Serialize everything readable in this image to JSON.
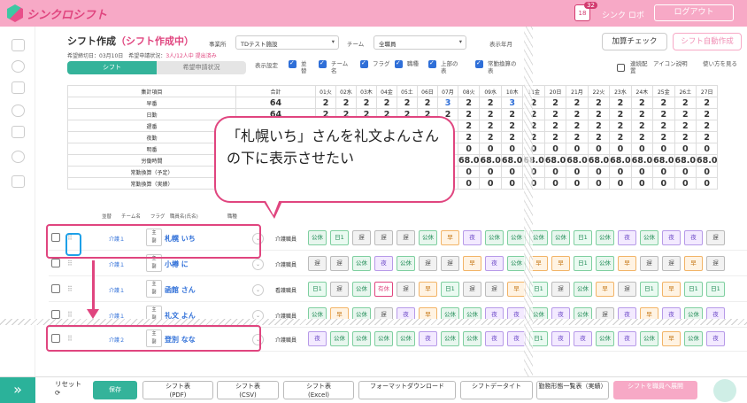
{
  "app": {
    "name": "シンクロシフト",
    "notif_count": "32",
    "calendar_day": "18",
    "robot": "シンク ロボ",
    "logout": "ログアウト"
  },
  "header": {
    "title": "シフト作成",
    "status": "（シフト作成中）",
    "office_label": "事業所",
    "office_value": "TDテスト施設",
    "team_label": "チーム",
    "team_value": "全職員",
    "month_label": "表示年月",
    "btn_add": "加算チェック",
    "btn_auto": "シフト自動作成"
  },
  "note": {
    "deadline": "希望締切日：03月10日",
    "state": "希望申請状況：",
    "state_value": "3人/12人中 提出済み"
  },
  "tabs": [
    "シフト",
    "希望申請状況"
  ],
  "options": {
    "label": "表示設定",
    "items": [
      "並替",
      "チーム名",
      "フラグ",
      "職種",
      "上部の表",
      "常勤換算の表",
      "表示"
    ],
    "consec": "連続配置",
    "icon_help": "アイコン説明",
    "howto": "使い方を見る"
  },
  "summary": {
    "hdr": {
      "name": "集計項目",
      "total": "合計",
      "days": [
        "01火",
        "02水",
        "03木",
        "04金",
        "05土",
        "06日",
        "07月",
        "08火",
        "09水",
        "10木",
        "11金",
        "20日",
        "21月",
        "22火",
        "23水",
        "24木",
        "25金",
        "26土",
        "27日"
      ]
    },
    "rows": [
      {
        "name": "早番",
        "total": "64",
        "vals": [
          "2",
          "2",
          "2",
          "2",
          "2",
          "2",
          "3",
          "2",
          "2",
          "3",
          "2",
          "2",
          "2",
          "2",
          "2",
          "2",
          "2",
          "2",
          "2"
        ]
      },
      {
        "name": "日勤",
        "total": "64",
        "vals": [
          "2",
          "2",
          "2",
          "2",
          "2",
          "2",
          "2",
          "2",
          "2",
          "2",
          "2",
          "2",
          "2",
          "2",
          "2",
          "2",
          "2",
          "2",
          "2"
        ]
      },
      {
        "name": "遅番",
        "total": "",
        "vals": [
          "2",
          "2",
          "2",
          "2",
          "2",
          "2",
          "2",
          "2",
          "2",
          "2",
          "2",
          "2",
          "2",
          "2",
          "2",
          "2",
          "2",
          "2",
          "2"
        ]
      },
      {
        "name": "夜勤",
        "total": "",
        "vals": [
          "2",
          "2",
          "2",
          "2",
          "2",
          "2",
          "2",
          "2",
          "2",
          "2",
          "2",
          "2",
          "2",
          "2",
          "2",
          "2",
          "2",
          "2",
          "2"
        ]
      },
      {
        "name": "明番",
        "total": "",
        "vals": [
          "0",
          "0",
          "0",
          "0",
          "0",
          "0",
          "0",
          "0",
          "0",
          "0",
          "0",
          "0",
          "0",
          "0",
          "0",
          "0",
          "0",
          "0",
          "0"
        ]
      },
      {
        "name": "労働時間",
        "total": "",
        "vals": [
          "",
          "",
          "",
          "",
          "",
          "",
          "6.0",
          "68.0",
          "68.0",
          "68.0",
          "68.0",
          "68.0",
          "68.0",
          "68.0",
          "68.0",
          "68.0",
          "68.0",
          "68.0",
          "68.0"
        ]
      },
      {
        "name": "常勤換算（予定）",
        "total": "",
        "vals": [
          "",
          "",
          "",
          "",
          "",
          "",
          "0",
          "0",
          "0",
          "0",
          "0",
          "0",
          "0",
          "0",
          "0",
          "0",
          "0",
          "0",
          "0"
        ]
      },
      {
        "name": "常勤換算（実績）",
        "total": "",
        "vals": [
          "",
          "",
          "",
          "",
          "",
          "",
          "0",
          "0",
          "0",
          "0",
          "0",
          "0",
          "0",
          "0",
          "0",
          "0",
          "0",
          "0",
          "0"
        ]
      }
    ]
  },
  "staff_hdr": {
    "sort": "並替",
    "team": "チーム名",
    "flag": "フラグ",
    "name": "職員名(氏名)",
    "job": "職種"
  },
  "staff": [
    {
      "team": "介護１",
      "flag1": "主",
      "flag2": "副",
      "name": "札幌 いち",
      "job": "介護職員",
      "cells": [
        "公休",
        "日1",
        "遅",
        "遅",
        "遅",
        "公休",
        "早",
        "夜",
        "公休",
        "公休",
        "公休",
        "公休",
        "日1",
        "公休",
        "夜",
        "公休",
        "夜",
        "夜",
        "遅"
      ]
    },
    {
      "team": "介護１",
      "flag1": "主",
      "flag2": "副",
      "name": "小樽 に",
      "job": "介護職員",
      "cells": [
        "遅",
        "遅",
        "公休",
        "夜",
        "公休",
        "遅",
        "遅",
        "早",
        "夜",
        "公休",
        "早",
        "早",
        "日1",
        "公休",
        "早",
        "遅",
        "遅",
        "早",
        "遅"
      ]
    },
    {
      "team": "介護１",
      "flag1": "主",
      "flag2": "副",
      "name": "函館 さん",
      "job": "看護職員",
      "cells": [
        "日1",
        "遅",
        "公休",
        "有休",
        "遅",
        "早",
        "日1",
        "遅",
        "遅",
        "早",
        "日1",
        "遅",
        "公休",
        "早",
        "遅",
        "日1",
        "早",
        "日1",
        "日1"
      ]
    },
    {
      "team": "介護１",
      "flag1": "主",
      "flag2": "副",
      "name": "礼文 よん",
      "job": "介護職員",
      "cells": [
        "公休",
        "早",
        "公休",
        "遅",
        "夜",
        "早",
        "公休",
        "公休",
        "夜",
        "夜",
        "公休",
        "夜",
        "公休",
        "遅",
        "夜",
        "早",
        "夜",
        "公休",
        "夜"
      ]
    },
    {
      "team": "介護２",
      "flag1": "主",
      "flag2": "副",
      "name": "登別 なな",
      "job": "介護職員",
      "cells": [
        "夜",
        "公休",
        "公休",
        "公休",
        "公休",
        "夜",
        "公休",
        "公休",
        "夜",
        "夜",
        "日1",
        "夜",
        "夜",
        "公休",
        "夜",
        "公休",
        "早",
        "公休",
        "夜"
      ]
    }
  ],
  "callout": "「札幌いち」さんを礼文よんさんの下に表示させたい",
  "bottom": {
    "reset": "リセット",
    "save": "保存",
    "pdf": "シフト表\n(PDF)",
    "csv": "シフト表\n(CSV)",
    "excel": "シフト表\n(Excel)",
    "format": "フォーマットダウンロード",
    "data": "シフトデータイト",
    "list": "勤務形態一覧表（実績）",
    "send": "シフトを職員へ展開"
  }
}
